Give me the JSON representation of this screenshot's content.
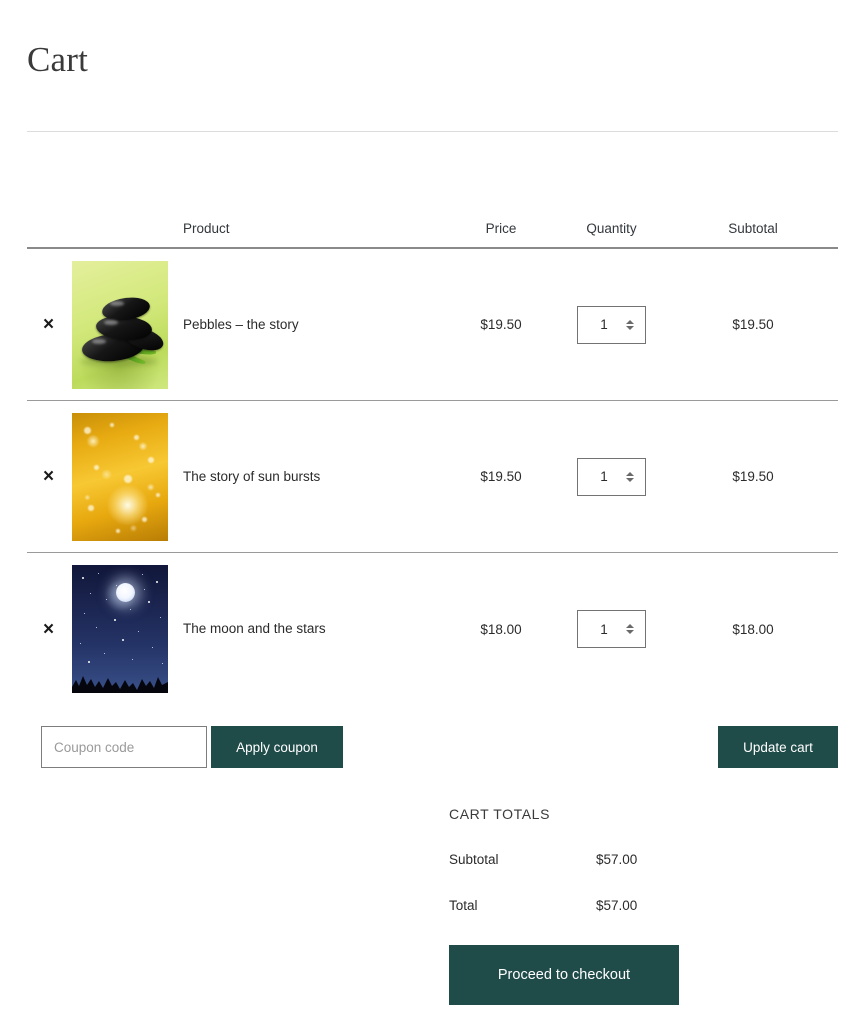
{
  "page": {
    "title": "Cart"
  },
  "table": {
    "headers": {
      "remove": "",
      "thumb": "",
      "product": "Product",
      "price": "Price",
      "quantity": "Quantity",
      "subtotal": "Subtotal"
    },
    "remove_icon_label": "×",
    "rows": [
      {
        "name": "Pebbles – the story",
        "price": "$19.50",
        "qty": "1",
        "subtotal": "$19.50",
        "image_name": "product-image-pebbles"
      },
      {
        "name": "The story of sun bursts",
        "price": "$19.50",
        "qty": "1",
        "subtotal": "$19.50",
        "image_name": "product-image-sun-bursts"
      },
      {
        "name": "The moon and the stars",
        "price": "$18.00",
        "qty": "1",
        "subtotal": "$18.00",
        "image_name": "product-image-moon-and-stars"
      }
    ]
  },
  "actions": {
    "coupon_placeholder": "Coupon code",
    "coupon_value": "",
    "apply_coupon_label": "Apply coupon",
    "update_cart_label": "Update cart"
  },
  "totals": {
    "title": "CART TOTALS",
    "subtotal_label": "Subtotal",
    "subtotal_value": "$57.00",
    "total_label": "Total",
    "total_value": "$57.00",
    "checkout_label": "Proceed to checkout"
  },
  "colors": {
    "button_background": "#1f4b49",
    "button_text": "#ffffff",
    "text": "#2b2b2b",
    "rule": "#dcdcdc",
    "row_divider": "#9a9a9a",
    "header_divider": "#8a8a8a"
  }
}
